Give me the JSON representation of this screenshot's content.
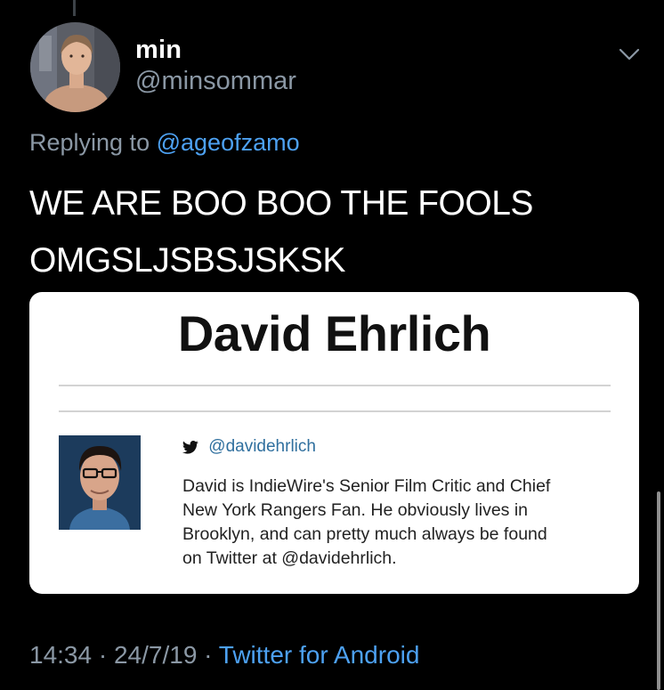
{
  "tweet": {
    "author": {
      "display_name": "min",
      "handle": "@minsommar"
    },
    "replying_prefix": "Replying to",
    "replying_to": "@ageofzamo",
    "text_lines": [
      "WE ARE BOO BOO THE FOOLS",
      "OMGSLJSBSJSKSK"
    ],
    "time": "14:34",
    "date": "24/7/19",
    "separator": "·",
    "source": "Twitter for Android"
  },
  "media_card": {
    "title": "David Ehrlich",
    "twitter_handle": "@davidehrlich",
    "bio_lines": [
      "David is IndieWire's Senior Film Critic and Chief",
      "New York Rangers Fan. He obviously lives in",
      "Brooklyn, and can pretty much always be found",
      "on Twitter at @davidehrlich."
    ]
  },
  "icons": {
    "menu": "chevron-down-icon",
    "twitter": "twitter-bird-icon"
  },
  "colors": {
    "background": "#000000",
    "secondary_text": "#8b98a5",
    "link": "#4da1f2",
    "card_link": "#2f6f9e"
  }
}
